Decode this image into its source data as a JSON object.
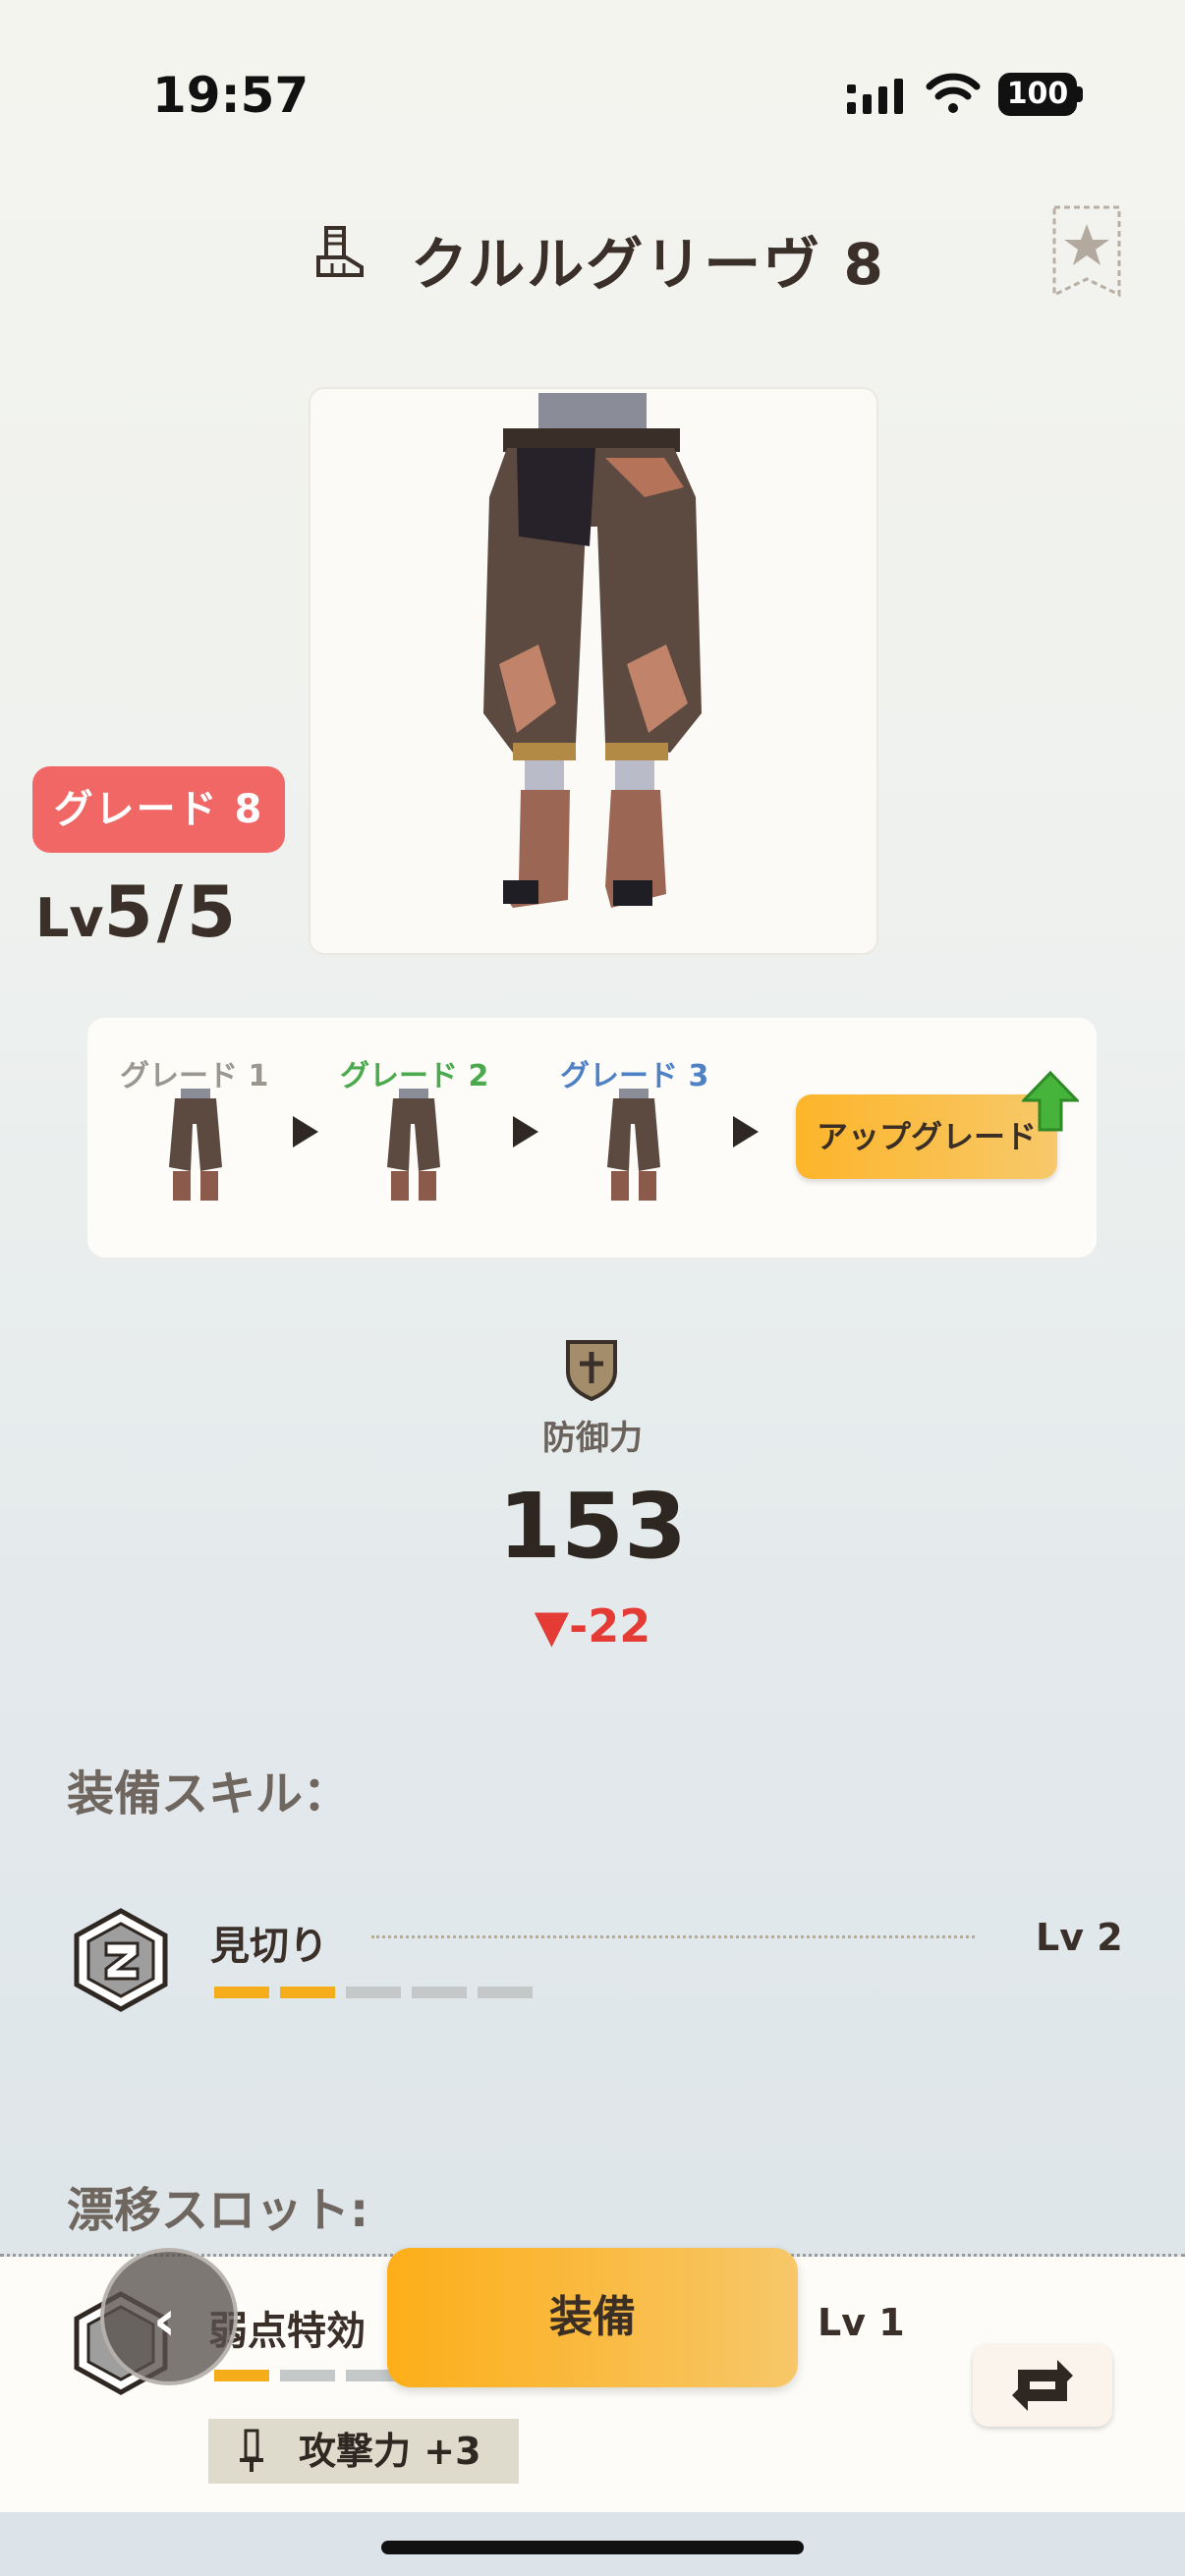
{
  "status_bar": {
    "time": "19:57",
    "battery": "100"
  },
  "header": {
    "title": "クルルグリーヴ 8"
  },
  "item": {
    "grade_badge": "グレード 8",
    "level_prefix": "Lv",
    "level_value": "5/5"
  },
  "grades": {
    "items": [
      {
        "label": "グレード 1",
        "color": "#9a9690"
      },
      {
        "label": "グレード 2",
        "color": "#4caa4e"
      },
      {
        "label": "グレード 3",
        "color": "#4f82c5"
      }
    ],
    "upgrade_label": "アップグレード"
  },
  "defense": {
    "label": "防御力",
    "value": "153",
    "diff": "-22",
    "diff_color": "#e53b35"
  },
  "skills": {
    "title": "装備スキル：",
    "items": [
      {
        "name": "見切り",
        "level": "Lv 2",
        "level_value": 2,
        "level_max": 5
      }
    ]
  },
  "drift_slot": {
    "title": "漂移スロット:",
    "skill_name": "弱点特効",
    "level": "Lv 1",
    "level_value": 1,
    "bonus": "攻撃力 +3"
  },
  "actions": {
    "equip_label": "装備"
  },
  "colors": {
    "accent": "#fdae19",
    "grade_badge": "#f06766",
    "pip_on": "#f6ad1b",
    "pip_off": "#c4c8c8"
  }
}
